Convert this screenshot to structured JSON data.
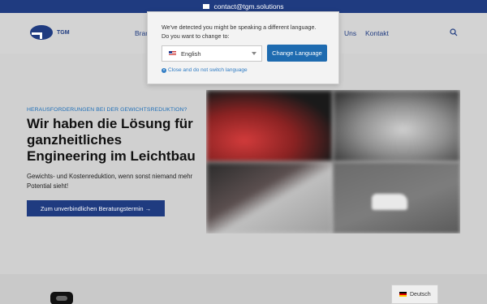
{
  "topbar": {
    "email": "contact@tgm.solutions",
    "icon": "mail-icon"
  },
  "logo": {
    "text": "TGM"
  },
  "nav": {
    "item_partial": "Bran",
    "about": "Uns",
    "contact": "Kontakt",
    "search_icon": "search-icon"
  },
  "lang_popup": {
    "message_line1": "We've detected you might be speaking a different language.",
    "message_line2": "Do you want to change to:",
    "selected_language": "English",
    "change_button": "Change Language",
    "close_link": "Close and do not switch language"
  },
  "hero": {
    "eyebrow": "HERAUSFORDERUNGEN BEI DER GEWICHTSREDUKTION?",
    "headline": "Wir haben die Lösung für ganzheitliches Engineering im Leichtbau",
    "subtext": "Gewichts- und Kostenreduktion, wenn sonst niemand mehr Potential sieht!",
    "cta": "Zum unverbindlichen Beratungstermin →"
  },
  "language_switcher": {
    "current": "Deutsch"
  },
  "colors": {
    "brand": "#1f3b80",
    "accent": "#1f6fb8",
    "button": "#1e6bb0"
  }
}
